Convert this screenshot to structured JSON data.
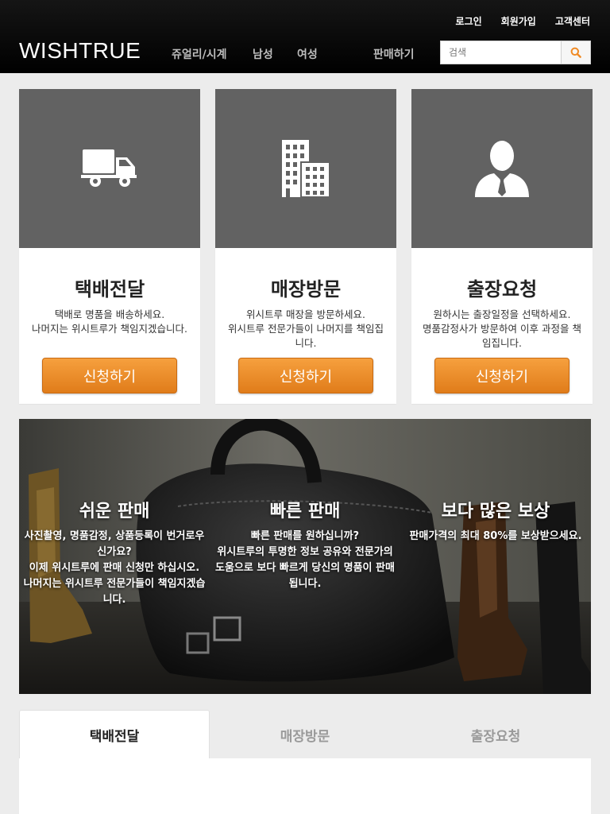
{
  "header": {
    "logo": "WISHTRUE",
    "top_links": [
      "로그인",
      "회원가입",
      "고객센터"
    ],
    "nav": [
      "쥬얼리/시계",
      "남성",
      "여성",
      "판매하기"
    ],
    "search_placeholder": "검색",
    "search_icon": "magnifier-icon"
  },
  "services": [
    {
      "icon": "truck-icon",
      "title": "택배전달",
      "desc": "택배로 명품을 배송하세요.\n나머지는 위시트루가 책임지겠습니다.",
      "button": "신청하기"
    },
    {
      "icon": "building-icon",
      "title": "매장방문",
      "desc": "위시트루 매장을 방문하세요.\n위시트루 전문가들이 나머지를 책임집니다.",
      "button": "신청하기"
    },
    {
      "icon": "person-icon",
      "title": "출장요청",
      "desc": "원하시는 출장일정을 선택하세요.\n명품감정사가 방문하여 이후 과정을 책임집니다.",
      "button": "신청하기"
    }
  ],
  "banner": [
    {
      "title": "쉬운 판매",
      "text": "사진촬영, 명품감정, 상품등록이 번거로우신가요?\n이제 위시트루에 판매 신청만 하십시오.\n나머지는 위시트루 전문가들이 책임지겠습니다."
    },
    {
      "title": "빠른 판매",
      "text": "빠른 판매를 원하십니까?\n위시트루의 투명한 정보 공유와 전문가의 도움으로 보다 빠르게 당신의 명품이 판매됩니다."
    },
    {
      "title": "보다 많은 보상",
      "text": "판매가격의 최대 80%를 보상받으세요."
    }
  ],
  "tabs": [
    "택배전달",
    "매장방문",
    "출장요청"
  ],
  "colors": {
    "accent": "#f08a24",
    "header_bg": "#000000",
    "card_icon_bg": "#626262"
  }
}
